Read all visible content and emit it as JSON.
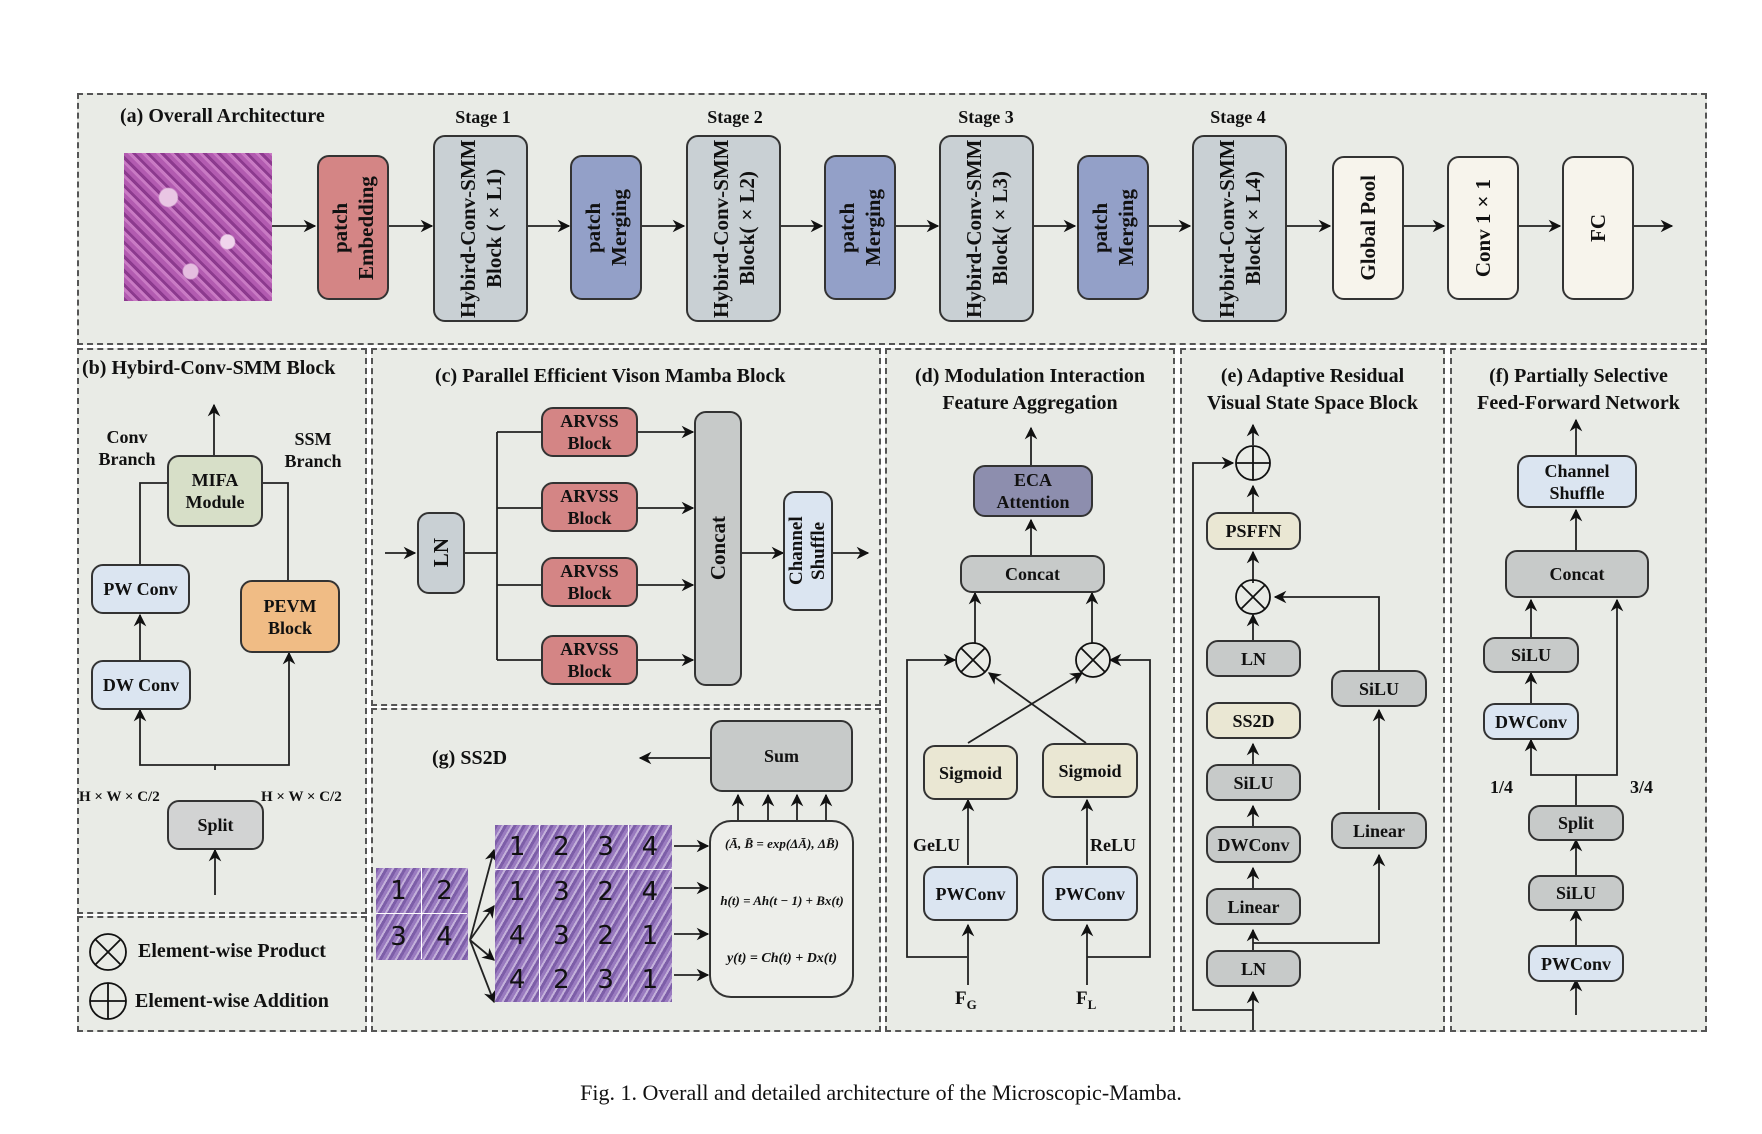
{
  "caption": "Fig. 1.  Overall and detailed architecture of the Microscopic-Mamba.",
  "panel_a": {
    "title": "(a) Overall Architecture",
    "stages": [
      "Stage 1",
      "Stage 2",
      "Stage 3",
      "Stage 4"
    ],
    "patch_embedding": "patch Embedding",
    "patch_merging": "patch Merging",
    "blocks": [
      "Hybird-Conv-SMM Block (×L1)",
      "Hybird-Conv-SMM Block(×L2)",
      "Hybird-Conv-SMM Block(×L3)",
      "Hybird-Conv-SMM Block(×L4)"
    ],
    "global_pool": "Global Pool",
    "conv1x1": "Conv 1×1",
    "fc": "FC"
  },
  "panel_b": {
    "title": "(b) Hybird-Conv-SMM Block",
    "conv_branch": "Conv Branch",
    "ssm_branch": "SSM Branch",
    "mifa": "MIFA Module",
    "pw_conv": "PW Conv",
    "dw_conv": "DW Conv",
    "pevm": "PEVM Block",
    "split": "Split",
    "dim_left": "H × W × C/2",
    "dim_right": "H × W × C/2"
  },
  "panel_c": {
    "title": "(c) Parallel Efficient Vison Mamba Block",
    "ln": "LN",
    "arvss": [
      "ARVSS Block",
      "ARVSS Block",
      "ARVSS Block",
      "ARVSS Block"
    ],
    "concat": "Concat",
    "channel_shuffle": "Channel Shuffle"
  },
  "panel_d": {
    "title_line1": "(d) Modulation Interaction",
    "title_line2": "Feature Aggregation",
    "eca": "ECA Attention",
    "concat": "Concat",
    "sigmoid_left": "Sigmoid",
    "sigmoid_right": "Sigmoid",
    "gelu": "GeLU",
    "relu": "ReLU",
    "pwconv_left": "PWConv",
    "pwconv_right": "PWConv",
    "input_g": "F",
    "input_g_sub": "G",
    "input_l": "F",
    "input_l_sub": "L"
  },
  "panel_e": {
    "title_line1": "(e) Adaptive Residual",
    "title_line2": "Visual State Space Block",
    "psffn": "PSFFN",
    "ln_top": "LN",
    "ss2d": "SS2D",
    "silu_main": "SiLU",
    "dwconv": "DWConv",
    "linear_main": "Linear",
    "ln_bottom": "LN",
    "silu_side": "SiLU",
    "linear_side": "Linear"
  },
  "panel_f": {
    "title_line1": "(f) Partially Selective",
    "title_line2": "Feed-Forward Network",
    "channel_shuffle": "Channel Shuffle",
    "concat": "Concat",
    "silu_top": "SiLU",
    "dwconv": "DWConv",
    "ratio_left": "1/4",
    "ratio_right": "3/4",
    "split": "Split",
    "silu_bottom": "SiLU",
    "pwconv": "PWConv"
  },
  "panel_g": {
    "title": "(g) SS2D",
    "sum": "Sum",
    "input_tiles": [
      "1",
      "2",
      "3",
      "4"
    ],
    "scan_rows": [
      [
        "1",
        "2",
        "3",
        "4"
      ],
      [
        "1",
        "3",
        "2",
        "4"
      ],
      [
        "4",
        "3",
        "2",
        "1"
      ],
      [
        "4",
        "2",
        "3",
        "1"
      ]
    ],
    "eq1": "(Ā, B̄ = exp(ΔĀ), ΔB̄)",
    "eq2": "h(t) = Ah(t − 1) + Bx(t)",
    "eq3": "y(t) = Ch(t) + Dx(t)"
  },
  "legend": {
    "product": "Element-wise Product",
    "addition": "Element-wise Addition"
  }
}
